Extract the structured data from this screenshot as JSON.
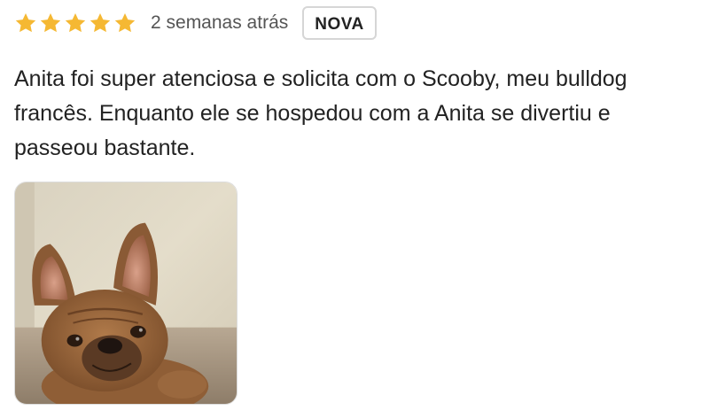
{
  "review": {
    "rating": 5,
    "rating_max": 5,
    "star_color": "#f5b833",
    "date": "2 semanas atrás",
    "badge": "NOVA",
    "text": "Anita foi super atenciosa e solicita com o Scooby, meu bulldog francês. Enquanto ele se hospedou com a Anita se divertiu e passeou bastante.",
    "photo": {
      "icon": "dog-photo"
    }
  }
}
